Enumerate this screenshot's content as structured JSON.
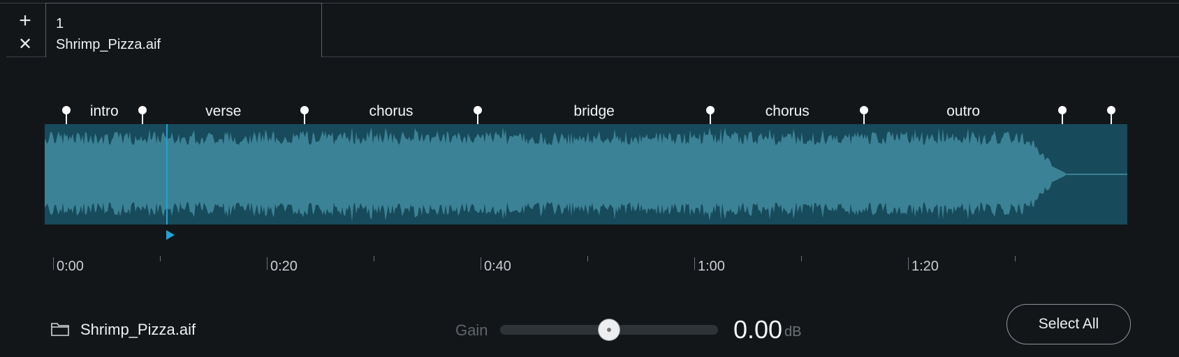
{
  "tabs": {
    "add_label": "+",
    "close_label": "✕",
    "active": {
      "number": "1",
      "filename": "Shrimp_Pizza.aif"
    }
  },
  "segments": [
    {
      "label": "intro",
      "start": 0.02,
      "end": 0.09
    },
    {
      "label": "verse",
      "start": 0.09,
      "end": 0.24
    },
    {
      "label": "chorus",
      "start": 0.24,
      "end": 0.4
    },
    {
      "label": "bridge",
      "start": 0.4,
      "end": 0.615
    },
    {
      "label": "chorus",
      "start": 0.615,
      "end": 0.757
    },
    {
      "label": "outro",
      "start": 0.757,
      "end": 0.94
    }
  ],
  "markers": [
    0.02,
    0.09,
    0.24,
    0.4,
    0.615,
    0.757,
    0.94,
    0.985
  ],
  "playhead": 0.112,
  "timeline": {
    "labels": [
      "0:00",
      "0:20",
      "0:40",
      "1:00",
      "1:20"
    ]
  },
  "footer": {
    "icon": "folder-icon",
    "filename": "Shrimp_Pizza.aif",
    "gain_label": "Gain",
    "gain_position": 0.5,
    "gain_value": "0.00",
    "gain_unit": "dB",
    "select_all_label": "Select All"
  },
  "colors": {
    "waveform_bg": "#174a5a",
    "waveform_fill": "#3c8297",
    "accent": "#1ea3d6"
  }
}
